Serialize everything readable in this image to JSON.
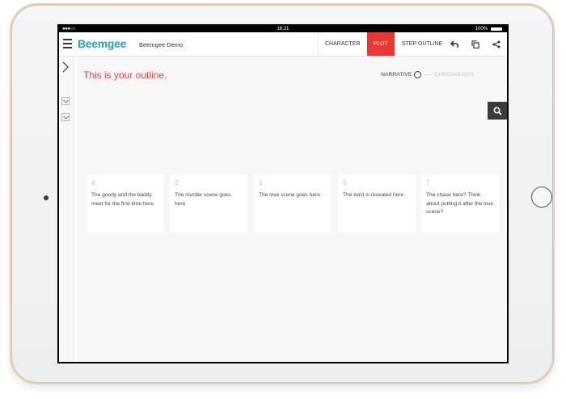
{
  "status_bar": {
    "signal": "●●●○○",
    "time": "16:21",
    "battery": "100%"
  },
  "header": {
    "logo": "Beemgee",
    "project": "Beemgee Demo",
    "tabs": [
      {
        "label": "CHARACTER",
        "active": false
      },
      {
        "label": "PLOT",
        "active": true
      },
      {
        "label": "STEP OUTLINE",
        "active": false
      }
    ],
    "icons": [
      "undo-icon",
      "copy-icon",
      "share-icon"
    ]
  },
  "main": {
    "title": "This is your outline.",
    "toggle": {
      "left": "NARRATIVE",
      "right": "CHRONOLOGY"
    }
  },
  "cards": [
    {
      "number": "4",
      "text": "The goody and the baddy meet for the first time here"
    },
    {
      "number": "2",
      "text": "The murder scene goes here"
    },
    {
      "number": "1",
      "text": "The love scene goes here"
    },
    {
      "number": "5",
      "text": "The twist is revealed here."
    },
    {
      "number": "7",
      "text": "The chase here? Think about putting it after the love scene?"
    }
  ],
  "colors": {
    "accent": "#e53935",
    "logo": "#2aa3ae",
    "title": "#e04444"
  }
}
